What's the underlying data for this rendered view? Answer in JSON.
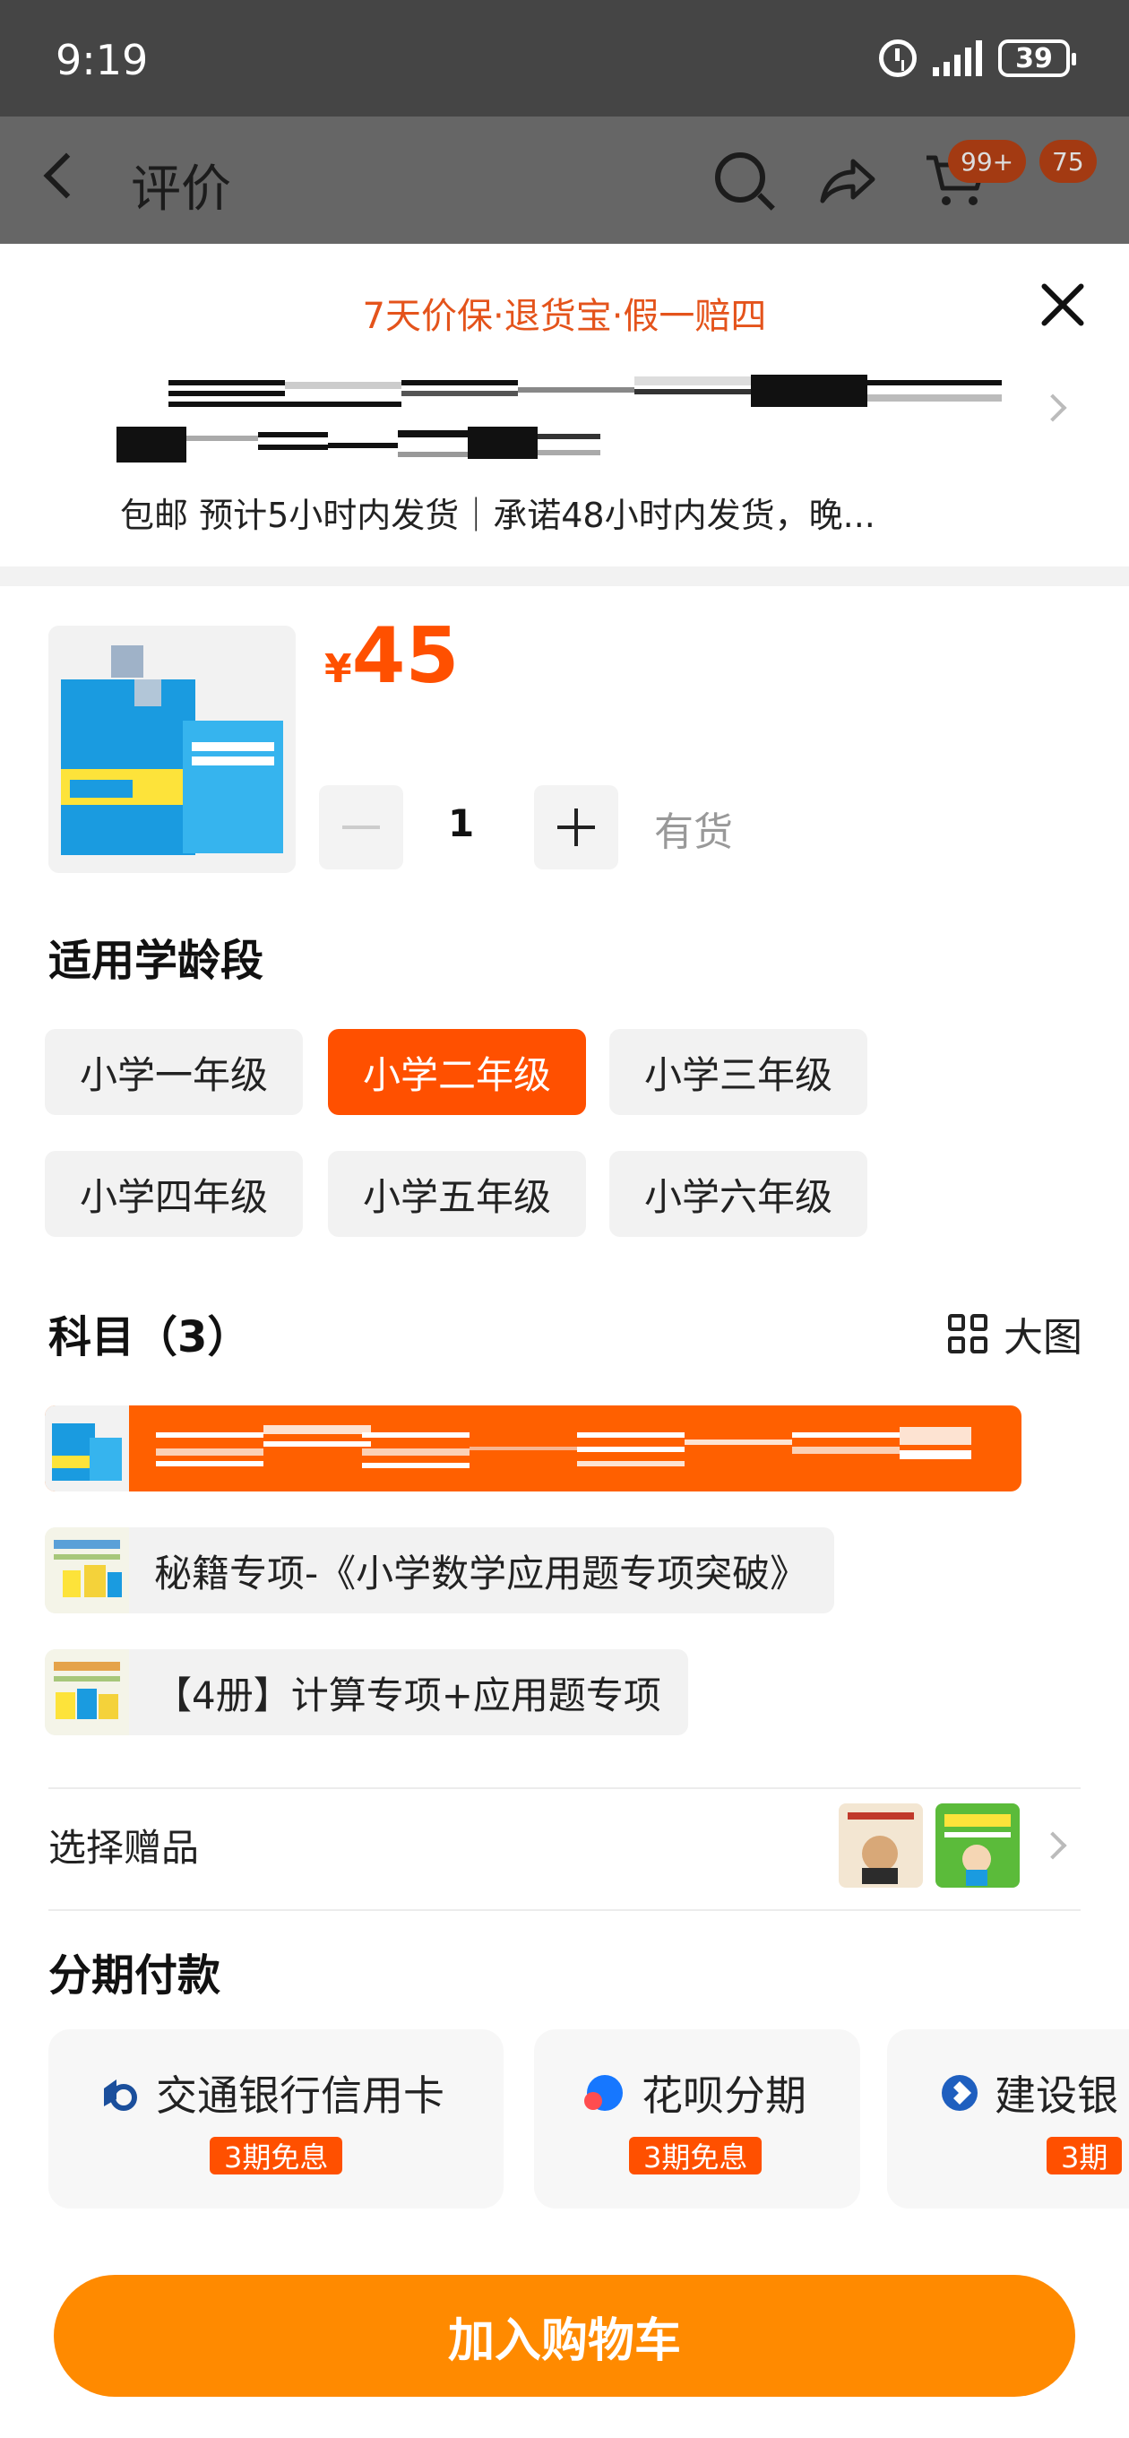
{
  "status_bar": {
    "time": "9:19",
    "battery": "39"
  },
  "nav": {
    "title": "评价",
    "cart_badge": "99+",
    "message_badge": "75"
  },
  "sheet": {
    "promo": "7天价保·退货宝·假一赔四",
    "shipping": "包邮 预计5小时内发货｜承诺48小时内发货，晚..."
  },
  "product": {
    "price_symbol": "¥",
    "price": "45",
    "quantity": "1",
    "stock": "有货"
  },
  "grade_section": {
    "title": "适用学龄段",
    "options": [
      "小学一年级",
      "小学二年级",
      "小学三年级",
      "小学四年级",
      "小学五年级",
      "小学六年级"
    ],
    "selected": "小学二年级"
  },
  "subject_section": {
    "title": "科目（3）",
    "view_toggle": "大图",
    "options": [
      "秘籍专项-《小学数学应用题专项突破》",
      "【4册】计算专项+应用题专项"
    ]
  },
  "gift": {
    "label": "选择赠品"
  },
  "installment": {
    "title": "分期付款",
    "options": [
      {
        "name": "交通银行信用卡",
        "badge": "3期免息"
      },
      {
        "name": "花呗分期",
        "badge": "3期免息"
      },
      {
        "name": "建设银",
        "badge": "3期"
      }
    ]
  },
  "footer": {
    "add_to_cart": "加入购物车"
  },
  "colors": {
    "accent": "#ff5000",
    "cta": "#ff8a00"
  }
}
